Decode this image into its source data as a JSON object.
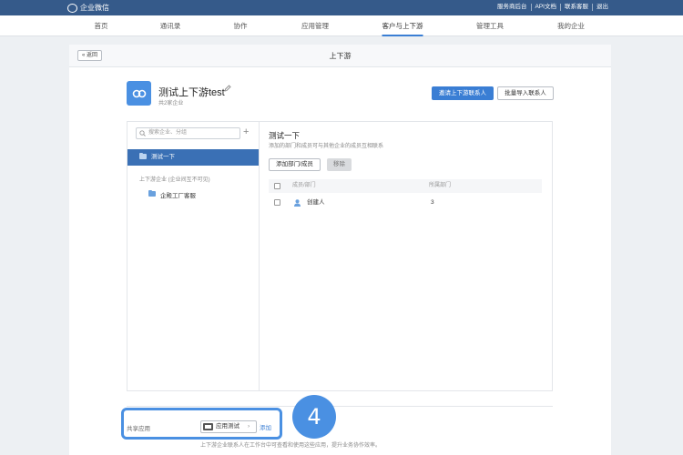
{
  "topbar": {
    "logo_text": "企业微信",
    "links": [
      "服务商后台",
      "API文档",
      "联系客服",
      "退出"
    ]
  },
  "nav": {
    "items": [
      "首页",
      "通讯录",
      "协作",
      "应用管理",
      "客户与上下游",
      "管理工具",
      "我的企业"
    ],
    "active_index": 4
  },
  "panel": {
    "back_label": "« 返回",
    "title": "上下游"
  },
  "group": {
    "name": "测试上下游test",
    "subtitle": "共2家企业",
    "primary_button": "邀请上下游联系人",
    "secondary_button": "批量导入联系人"
  },
  "sidebar": {
    "search_placeholder": "搜索企业、分组",
    "selected_item": "测试一下",
    "section_label": "上下游企业 (企业间互不可见)",
    "items": [
      "企殿工厂客服"
    ]
  },
  "main": {
    "title": "测试一下",
    "subtitle": "添加的部门和成员可与其他企业的成员互相联系",
    "add_button": "添加部门/成员",
    "delete_button": "移除",
    "columns": [
      "成员/部门",
      "所属部门"
    ],
    "rows": [
      {
        "name": "创建人",
        "dept": "3"
      }
    ]
  },
  "share": {
    "label": "共享应用",
    "app_name": "应用测试",
    "add_link": "添加",
    "footnote": "上下游企业联系人在工作台中可查看和使用这些应用，提升业务协作效率。"
  },
  "annotation": {
    "step_number": "4"
  },
  "colors": {
    "topbar": "#355a8a",
    "accent": "#3a7ed4",
    "highlight": "#4a90e2"
  }
}
